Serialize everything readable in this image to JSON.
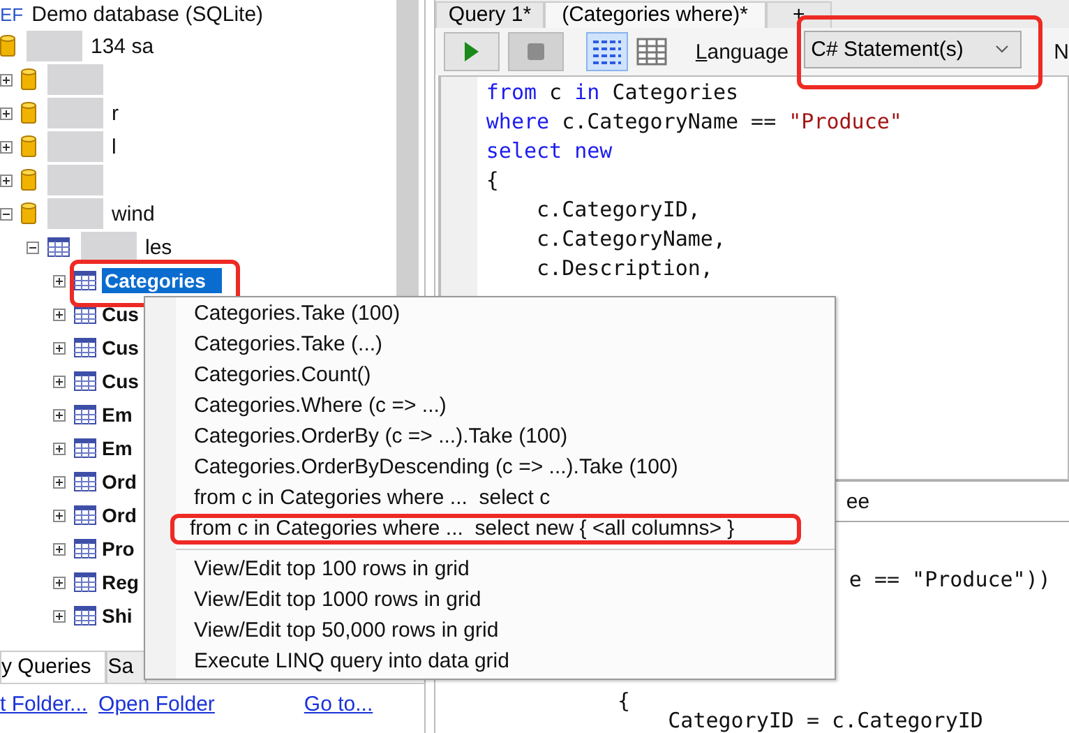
{
  "explorer": {
    "root": {
      "badge": "EF",
      "label": "Demo database (SQLite)"
    },
    "nodes": [
      {
        "kind": "connection",
        "label": "134 sa",
        "redacted": true,
        "children": [
          {
            "kind": "database",
            "redacted": true,
            "expanded": false
          },
          {
            "kind": "database",
            "label": "r",
            "redacted": true,
            "expanded": false
          },
          {
            "kind": "database",
            "label": "l",
            "redacted": true,
            "expanded": false
          },
          {
            "kind": "database",
            "redacted": true,
            "expanded": false
          },
          {
            "kind": "database",
            "label": "wind",
            "redacted": true,
            "expanded": true,
            "children": [
              {
                "kind": "folder",
                "label": "les",
                "redacted": true,
                "expanded": true,
                "children": [
                  {
                    "kind": "table",
                    "label": "Categories",
                    "selected": true,
                    "highlighted": true,
                    "expanded": false
                  },
                  {
                    "kind": "table",
                    "label": "Cus",
                    "selected": false,
                    "expanded": false
                  },
                  {
                    "kind": "table",
                    "label": "Cus",
                    "selected": false,
                    "expanded": false
                  },
                  {
                    "kind": "table",
                    "label": "Cus",
                    "selected": false,
                    "expanded": false
                  },
                  {
                    "kind": "table",
                    "label": "Em",
                    "selected": false,
                    "expanded": false
                  },
                  {
                    "kind": "table",
                    "label": "Em",
                    "selected": false,
                    "expanded": false
                  },
                  {
                    "kind": "table",
                    "label": "Ord",
                    "selected": false,
                    "expanded": false
                  },
                  {
                    "kind": "table",
                    "label": "Ord",
                    "selected": false,
                    "expanded": false
                  },
                  {
                    "kind": "table",
                    "label": "Pro",
                    "selected": false,
                    "expanded": false
                  },
                  {
                    "kind": "table",
                    "label": "Reg",
                    "selected": false,
                    "expanded": false
                  },
                  {
                    "kind": "table",
                    "label": "Shi",
                    "selected": false,
                    "expanded": false
                  }
                ]
              }
            ]
          }
        ]
      }
    ],
    "tabs": [
      {
        "label": "y Queries",
        "selected": true
      },
      {
        "label": "Sa",
        "selected": false
      }
    ],
    "links": [
      "t Folder...",
      "Open Folder",
      "Go to..."
    ]
  },
  "query_tabs": [
    {
      "label": "Query 1*",
      "selected": false
    },
    {
      "label": "(Categories where)*",
      "selected": true
    },
    {
      "label": "+",
      "selected": false
    }
  ],
  "toolbar": {
    "views": [
      {
        "kind": "rich",
        "selected": true
      },
      {
        "kind": "grid",
        "selected": false
      }
    ],
    "language_label": "Language",
    "language": {
      "value": "C# Statement(s)",
      "highlighted": true
    },
    "trailing": "N"
  },
  "editor": {
    "lines": [
      [
        {
          "text": "from",
          "kind": "keyword"
        },
        {
          "text": " c ",
          "kind": "plain"
        },
        {
          "text": "in",
          "kind": "keyword"
        },
        {
          "text": " Categories",
          "kind": "plain"
        }
      ],
      [
        {
          "text": "where",
          "kind": "keyword"
        },
        {
          "text": " c.CategoryName == ",
          "kind": "plain"
        },
        {
          "text": "\"Produce\"",
          "kind": "string"
        }
      ],
      [
        {
          "text": "select",
          "kind": "keyword"
        },
        {
          "text": " new",
          "kind": "keyword"
        }
      ],
      [
        {
          "text": "{",
          "kind": "plain"
        }
      ],
      [
        {
          "text": "    c.CategoryID,",
          "kind": "plain"
        }
      ],
      [
        {
          "text": "    c.CategoryName,",
          "kind": "plain"
        }
      ],
      [
        {
          "text": "    c.Description,",
          "kind": "plain"
        }
      ]
    ]
  },
  "results": {
    "tab": "ee",
    "lines": [
      "e == \"Produce\"))",
      "    {",
      "        CategoryID = c.CategoryID"
    ]
  },
  "context_menu": {
    "sections": [
      [
        {
          "label": "Categories.Take (100)",
          "highlighted": false
        },
        {
          "label": "Categories.Take (...)",
          "highlighted": false
        },
        {
          "label": "Categories.Count()",
          "highlighted": false
        },
        {
          "label": "Categories.Where (c => ...)",
          "highlighted": false
        },
        {
          "label": "Categories.OrderBy (c => ...).Take (100)",
          "highlighted": false
        },
        {
          "label": "Categories.OrderByDescending (c => ...).Take (100)",
          "highlighted": false
        },
        {
          "label": "from c in Categories where ...  select c",
          "highlighted": false
        },
        {
          "label": "from c in Categories where ...  select new { <all columns> }",
          "highlighted": true
        }
      ],
      [
        {
          "label": "View/Edit top 100 rows in grid",
          "highlighted": false
        },
        {
          "label": "View/Edit top 1000 rows in grid",
          "highlighted": false
        },
        {
          "label": "View/Edit top 50,000 rows in grid",
          "highlighted": false
        },
        {
          "label": "Execute LINQ query into data grid",
          "highlighted": false
        }
      ]
    ]
  }
}
